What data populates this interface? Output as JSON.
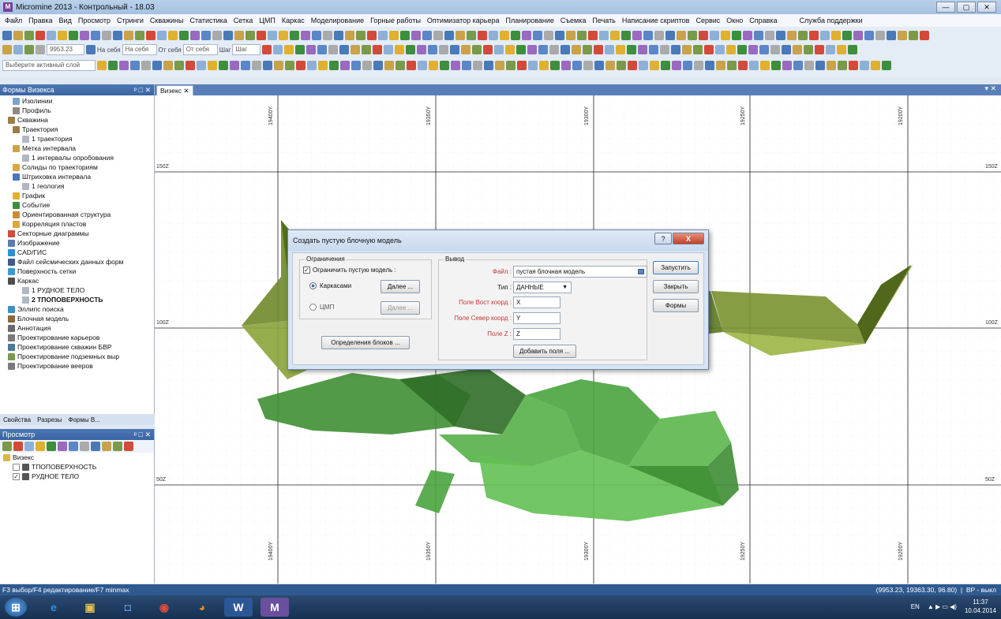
{
  "window": {
    "title": "Micromine 2013 - Контрольный - 18.03",
    "app_icon": "M"
  },
  "menu": [
    "Файл",
    "Правка",
    "Вид",
    "Просмотр",
    "Стринги",
    "Скважины",
    "Статистика",
    "Сетка",
    "ЦМП",
    "Каркас",
    "Моделирование",
    "Горные работы",
    "Оптимизатор карьера",
    "Планирование",
    "Съемка",
    "Печать",
    "Написание скриптов",
    "Сервис",
    "Окно",
    "Справка",
    "Служба поддержки"
  ],
  "toolbar": {
    "coord_value": "9953.23",
    "sel1": "На себя",
    "sel2": "На себя",
    "sel3": "От себя",
    "sel4": "От себя",
    "sel5": "Шаг",
    "sel6": "Шаг",
    "active_layer": "Выберите активный слой"
  },
  "left_panel": {
    "title": "Формы Визекса",
    "items": [
      {
        "label": "Изолинии",
        "indent": 2,
        "color": "#7aa3c9"
      },
      {
        "label": "Профиль",
        "indent": 2,
        "color": "#8a8a8a"
      },
      {
        "label": "Скважина",
        "indent": 1,
        "color": "#9b7d4a"
      },
      {
        "label": "Траектория",
        "indent": 2,
        "color": "#9b7d4a"
      },
      {
        "label": "1 траектория",
        "indent": 4,
        "color": "#b0b8c4"
      },
      {
        "label": "Метка интервала",
        "indent": 2,
        "color": "#c9a24b"
      },
      {
        "label": "1 интервалы опробования",
        "indent": 4,
        "color": "#b0b8c4"
      },
      {
        "label": "Солиды по траекториям",
        "indent": 2,
        "color": "#d9a640"
      },
      {
        "label": "Штриховка интервала",
        "indent": 2,
        "color": "#4a79b8"
      },
      {
        "label": "1 геология",
        "indent": 4,
        "color": "#b0b8c4"
      },
      {
        "label": "График",
        "indent": 2,
        "color": "#e0b030"
      },
      {
        "label": "Событие",
        "indent": 2,
        "color": "#3d8f3d"
      },
      {
        "label": "Ориентированная структура",
        "indent": 2,
        "color": "#c98a3a"
      },
      {
        "label": "Корреляция пластов",
        "indent": 2,
        "color": "#d9a640"
      },
      {
        "label": "Секторные диаграммы",
        "indent": 1,
        "color": "#d34a3a"
      },
      {
        "label": "Изображение",
        "indent": 1,
        "color": "#5b7db3"
      },
      {
        "label": "CAD/ГИС",
        "indent": 1,
        "color": "#2f8fd6"
      },
      {
        "label": "Файл сейсмических данных форм",
        "indent": 1,
        "color": "#3d5c8a"
      },
      {
        "label": "Поверхность сетки",
        "indent": 1,
        "color": "#3a9ad6"
      },
      {
        "label": "Каркас",
        "indent": 1,
        "color": "#4d4d4d"
      },
      {
        "label": "1 РУДНОЕ ТЕЛО",
        "indent": 4,
        "color": "#b0b8c4"
      },
      {
        "label": "2 ТПОПОВЕРХНОСТЬ",
        "indent": 4,
        "color": "#b0b8c4",
        "bold": true
      },
      {
        "label": "Эллипс поиска",
        "indent": 1,
        "color": "#3d8fc4"
      },
      {
        "label": "Блочная модель",
        "indent": 1,
        "color": "#8a6a3a"
      },
      {
        "label": "Аннотация",
        "indent": 1,
        "color": "#6a6a6a"
      },
      {
        "label": "Проектирование карьеров",
        "indent": 1,
        "color": "#7a7a7a"
      },
      {
        "label": "Проектирование скважин БВР",
        "indent": 1,
        "color": "#4a7a9a"
      },
      {
        "label": "Проектирование подземных выр",
        "indent": 1,
        "color": "#7a9a4a"
      },
      {
        "label": "Проектирование вееров",
        "indent": 1,
        "color": "#7a7a7a"
      }
    ],
    "tabs": [
      "Свойства",
      "Разрезы",
      "Формы В..."
    ]
  },
  "preview_panel": {
    "title": "Просмотр",
    "root": "Визекс",
    "layers": [
      {
        "label": "ТПОПОВЕРХНОСТЬ",
        "checked": false
      },
      {
        "label": "РУДНОЕ ТЕЛО",
        "checked": true
      }
    ]
  },
  "doc_tab": "Визекс",
  "canvas": {
    "x_labels": [
      "19400Y",
      "19350Y",
      "19300Y",
      "19250Y",
      "19200Y"
    ],
    "z_labels": [
      "150Z",
      "100Z",
      "50Z"
    ]
  },
  "dialog": {
    "title": "Создать пустую блочную модель",
    "constraints": {
      "group": "Ограничения",
      "checkbox": "Ограничить пустую модель :",
      "checked": true,
      "radio1": "Каркасами",
      "radio2": "ЦМП",
      "more1": "Далее ...",
      "more2": "Далее ...",
      "define_blocks": "Определения блоков ..."
    },
    "output": {
      "group": "Вывод",
      "file_label": "Файл :",
      "file_value": "пустая блочная модель",
      "type_label": "Тип :",
      "type_value": "ДАННЫЕ",
      "east_label": "Поле Вост коорд :",
      "east_value": "X",
      "north_label": "Поле Север коорд :",
      "north_value": "Y",
      "z_label": "Поле Z :",
      "z_value": "Z",
      "add_fields": "Добавить поля ..."
    },
    "buttons": {
      "run": "Запустить",
      "close": "Закрыть",
      "forms": "Формы"
    },
    "help": "?",
    "close_x": "X"
  },
  "status": {
    "left": "F3 выбор/F4 редактирование/F7 minmax",
    "coords": "(9953.23, 19363.30, 96.80)",
    "bp": "BP - выкл"
  },
  "taskbar": {
    "apps": [
      "start",
      "ie",
      "explorer",
      "media",
      "chrome",
      "firefox",
      "word",
      "micromine"
    ],
    "lang": "EN",
    "time": "11:37",
    "date": "10.04.2014"
  }
}
